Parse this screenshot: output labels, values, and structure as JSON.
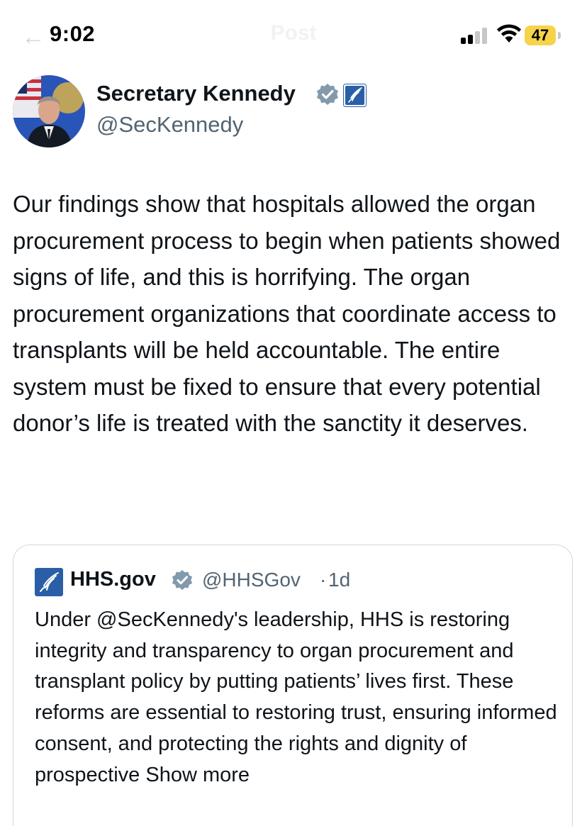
{
  "status_bar": {
    "time": "9:02",
    "screen_title": "Post",
    "battery": "47",
    "back_icon": "back-arrow-icon",
    "signal_icon": "cellular-signal-icon",
    "wifi_icon": "wifi-icon"
  },
  "author": {
    "name": "Secretary Kennedy",
    "handle": "@SecKennedy",
    "verified_icon": "verified-badge-icon",
    "affiliation_icon": "hhs-eagle-icon",
    "badge_color": "#829aab",
    "affiliation_color": "#2a5fa8"
  },
  "tweet": {
    "text": "Our findings show that hospitals allowed the organ procurement process to begin when patients showed signs of life, and this is horrifying. The organ procurement organizations that coordinate access to transplants will be held accountable. The entire system must be fixed to ensure that every potential donor’s life is treated with the sanctity it deserves."
  },
  "quote": {
    "name": "HHS.gov",
    "handle": "@HHSGov",
    "separator": "·",
    "time": "1d",
    "text": "Under @SecKennedy's leadership, HHS is restoring integrity and transparency to organ procurement and transplant policy by putting patients’ lives first. These reforms are essential to restoring trust, ensuring informed consent, and protecting the rights and dignity of prospective",
    "show_more": "Show more",
    "logo_icon": "hhs-logo-icon"
  }
}
